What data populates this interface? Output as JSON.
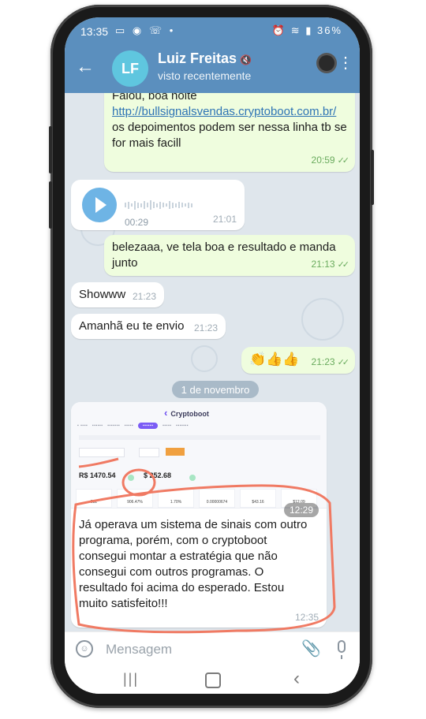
{
  "status_bar": {
    "time": "13:35",
    "battery": "36%",
    "left_icons": "▭ ◉ ☏ •",
    "right_icons": "⏰ ≋ ▮ "
  },
  "header": {
    "avatar_initials": "LF",
    "name": "Luiz Freitas",
    "status": "visto recentemente"
  },
  "messages": {
    "m1_text_a": "Falou, boa noite",
    "m1_link": "http://bullsignalsvendas.cryptoboot.com.br/",
    "m1_text_b": "os depoimentos podem ser nessa linha tb se for mais facill",
    "m1_time": "20:59",
    "voice_duration": "00:29",
    "voice_time": "21:01",
    "m3_text": "belezaaa, ve tela boa e resultado e manda junto",
    "m3_time": "21:13",
    "m4_text": "Showww",
    "m4_time": "21:23",
    "m5_text": "Amanhã eu te envio",
    "m5_time": "21:23",
    "m6_text": "👏👍👍",
    "m6_time": "21:23"
  },
  "date_divider": "1 de novembro",
  "photo_message": {
    "screenshot_brand": "Cryptoboot",
    "value_1": "R$ 1470.54",
    "value_2": "$ 252.68",
    "kpi_1": "532",
    "kpi_2": "906.47%",
    "kpi_3": "1.70%",
    "kpi_4": "0.00000674",
    "kpi_5": "$43.16",
    "kpi_6": "$12.09",
    "photo_time": "12:29",
    "caption": "Já operava um sistema de sinais com outro programa, porém, com o cryptoboot consegui montar a estratégia que não consegui com outros programas. O resultado foi acima do esperado. Estou muito satisfeito!!!",
    "time": "12:35"
  },
  "input": {
    "placeholder": "Mensagem"
  },
  "colors": {
    "header": "#5b8fbe",
    "outgoing": "#effdde",
    "incoming": "#ffffff",
    "annotation": "#f07a63",
    "avatar": "#5fc6df"
  }
}
